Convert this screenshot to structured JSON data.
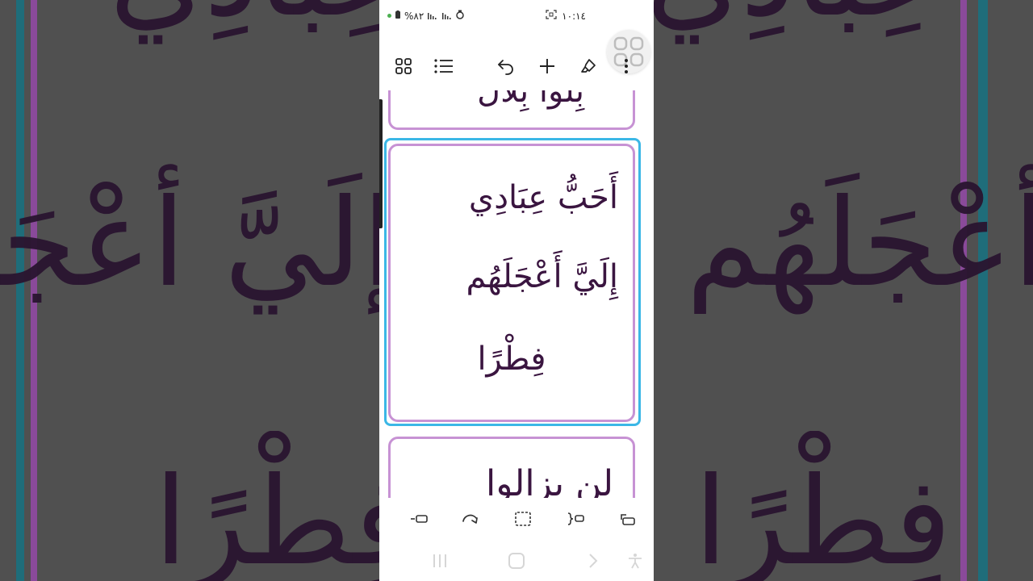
{
  "background": {
    "text_a": "إلَيَّ أعْجَلَهُم",
    "text_b": "عِبَادِي",
    "text_c": "فِطْرًا"
  },
  "status_bar": {
    "battery_percent": "%٨٢",
    "time": "١٠:١٤"
  },
  "toolbar": {
    "grid_icon": "grid-icon",
    "list_icon": "list-icon",
    "undo_icon": "undo-icon",
    "add_icon": "plus-icon",
    "highlight_icon": "highlighter-icon",
    "more_icon": "more-vertical-icon"
  },
  "cards": {
    "previous_line": "بِلُوا بِلَال",
    "current_line1": "أَحَبُّ عِبَادِي",
    "current_line2": "إِلَيَّ أَعْجَلَهُم",
    "current_line3": "فِطْرًا",
    "next_line": "لن يزالوا"
  },
  "colors": {
    "card_border": "#c792d4",
    "selection_outline": "#3bb7e6",
    "text": "#3a1540"
  }
}
